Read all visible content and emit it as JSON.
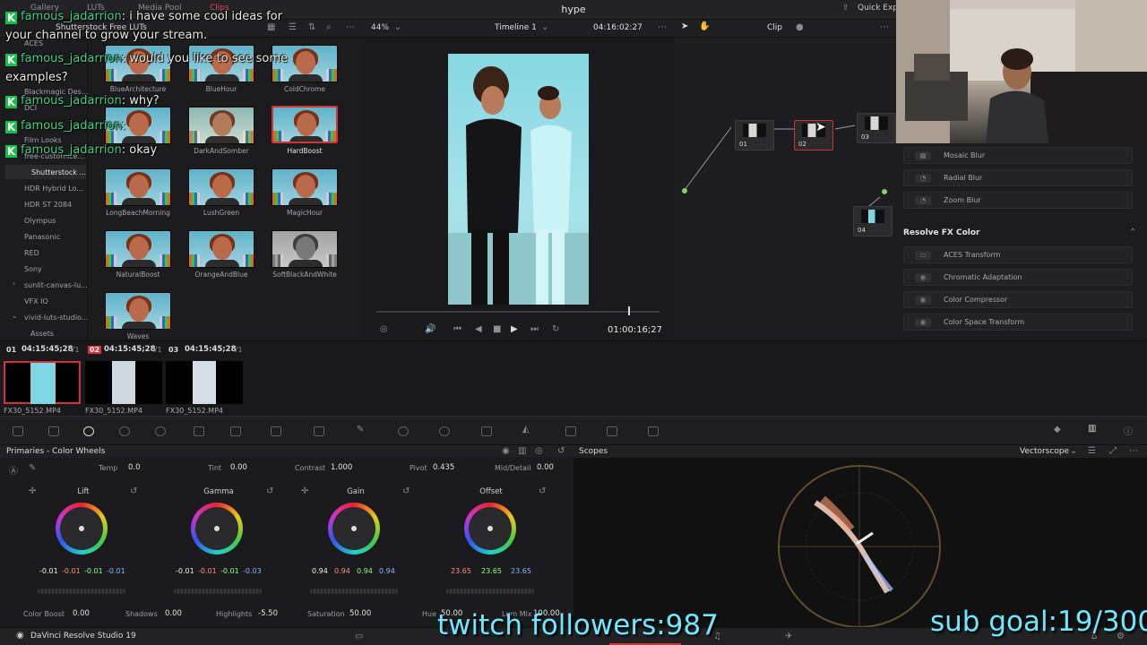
{
  "topbar": {
    "tabs": [
      "Gallery",
      "LUTs",
      "Media Pool",
      "Clips"
    ],
    "app_title": "hype",
    "right_label": "Quick Expo"
  },
  "bar2": {
    "lut_folder": "Shutterstock Free  LUTs",
    "zoom": "44%",
    "timeline": "Timeline 1",
    "timecode": "04:16:02:27",
    "mode": "Clip"
  },
  "lut_sidebar": {
    "items": [
      "ACES",
      "Blackmagic Des...",
      "DCI",
      "Film Looks",
      "free-customize...",
      "Shutterstock ...",
      "HDR Hybrid Lo...",
      "HDR ST 2084",
      "Olympus",
      "Panasonic",
      "RED",
      "Sony",
      "sunlit-canvas-lu...",
      "VFX IO",
      "vivid-luts-studio...",
      "Assets"
    ],
    "selected": "Shutterstock ..."
  },
  "luts": {
    "items": [
      "BlueArchitecture",
      "BlueHour",
      "ColdChrome",
      "",
      "DarkAndSomber",
      "HardBoost",
      "LongBeachMorning",
      "LushGreen",
      "MagicHour",
      "NaturalBoost",
      "OrangeAndBlue",
      "SoftBlackAndWhite",
      "Waves"
    ],
    "selected": "HardBoost"
  },
  "viewer": {
    "playhead_timecode": "01:00:16;27"
  },
  "nodes": {
    "labels": [
      "01",
      "02",
      "03",
      "04"
    ],
    "selected": "02"
  },
  "fx": {
    "blur_items": [
      "Mosaic Blur",
      "Radial Blur",
      "Zoom Blur"
    ],
    "section_title": "Resolve FX Color",
    "color_items": [
      "ACES Transform",
      "Chromatic Adaptation",
      "Color Compressor",
      "Color Space Transform"
    ]
  },
  "clips": [
    {
      "num": "01",
      "tc": "04:15:45;28",
      "track": "V1",
      "name": "FX30_5152.MP4"
    },
    {
      "num": "02",
      "tc": "04:15:45;28",
      "track": "V1",
      "name": "FX30_5152.MP4"
    },
    {
      "num": "03",
      "tc": "04:15:45;28",
      "track": "V1",
      "name": "FX30_5152.MP4"
    }
  ],
  "primaries": {
    "title": "Primaries - Color Wheels",
    "temp_label": "Temp",
    "temp": "0.0",
    "tint_label": "Tint",
    "tint": "0.00",
    "contrast_label": "Contrast",
    "contrast": "1.000",
    "pivot_label": "Pivot",
    "pivot": "0.435",
    "middetail_label": "Mid/Detail",
    "middetail": "0.00",
    "wheels": [
      {
        "name": "Lift",
        "values": [
          "-0.01",
          "-0.01",
          "-0.01",
          "-0.01"
        ]
      },
      {
        "name": "Gamma",
        "values": [
          "-0.01",
          "-0.01",
          "-0.01",
          "-0.03"
        ]
      },
      {
        "name": "Gain",
        "values": [
          "0.94",
          "0.94",
          "0.94",
          "0.94"
        ]
      },
      {
        "name": "Offset",
        "values": [
          "23.65",
          "23.65",
          "23.65"
        ]
      }
    ],
    "colorboost_label": "Color Boost",
    "colorboost": "0.00",
    "shadows_label": "Shadows",
    "shadows": "0.00",
    "highlights_label": "Highlights",
    "highlights": "-5.50",
    "saturation_label": "Saturation",
    "saturation": "50.00",
    "hue_label": "Hue",
    "hue": "50.00",
    "lummix_label": "Lum Mix",
    "lummix": "100.00"
  },
  "scopes": {
    "title": "Scopes",
    "mode": "Vectorscope"
  },
  "status": {
    "app_name": "DaVinci Resolve Studio 19"
  },
  "chat": [
    {
      "user": "famous_jadarrion",
      "text": ": i have some cool ideas for"
    },
    {
      "user": "",
      "text": "your channel to grow your stream."
    },
    {
      "user": "famous_jadarrion",
      "text": ": would you like to see some"
    },
    {
      "user": "",
      "text": "examples?"
    },
    {
      "user": "famous_jadarrion",
      "text": ": why?"
    },
    {
      "user": "famous_jadarrion",
      "text": ":"
    },
    {
      "user": "famous_jadarrion",
      "text": ": okay"
    }
  ],
  "overlay": {
    "followers": "twitch followers:987",
    "subgoal": "sub goal:19/300"
  },
  "colors": {
    "accent_red": "#d6303b",
    "chat_user": "#3fd28a",
    "overlay_text": "#6fe8ff",
    "twitch_green": "#15c04a"
  }
}
